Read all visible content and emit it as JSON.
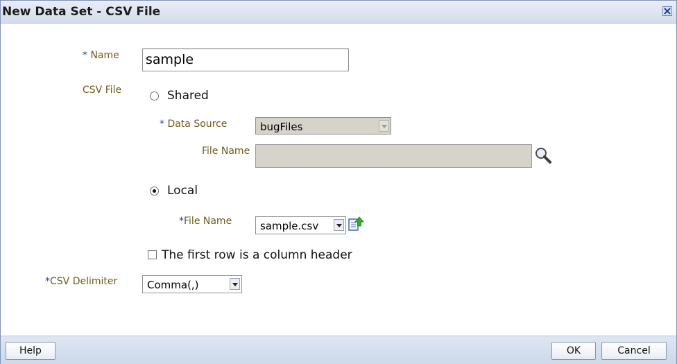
{
  "dialog": {
    "title": "New Data Set - CSV File"
  },
  "form": {
    "name_label_star": "*",
    "name_label": " Name",
    "name_value": "sample",
    "csv_file_label": "CSV File",
    "shared_label": "Shared",
    "data_source_label_star": "*",
    "data_source_label": " Data Source",
    "data_source_value": "bugFiles",
    "shared_file_name_label": "File Name",
    "shared_file_name_value": "",
    "local_label": "Local",
    "local_file_name_label_star": "*",
    "local_file_name_label": "File Name",
    "local_file_name_value": "sample.csv",
    "header_checkbox_label": "The first row is a column header",
    "csv_delimiter_label_star": "*",
    "csv_delimiter_label": "CSV Delimiter",
    "csv_delimiter_value": "Comma(,)"
  },
  "footer": {
    "help_label": "Help",
    "ok_label": "OK",
    "cancel_label": "Cancel"
  },
  "state": {
    "file_source_selected": "Local",
    "header_checkbox_checked": false
  },
  "icons": {
    "close": "close-icon",
    "search": "search-icon",
    "upload": "upload-icon",
    "dropdown": "chevron-down-icon"
  },
  "colors": {
    "label": "#6b5a1a",
    "required_star": "#1a43a9",
    "titlebar": "#d3dcec"
  }
}
